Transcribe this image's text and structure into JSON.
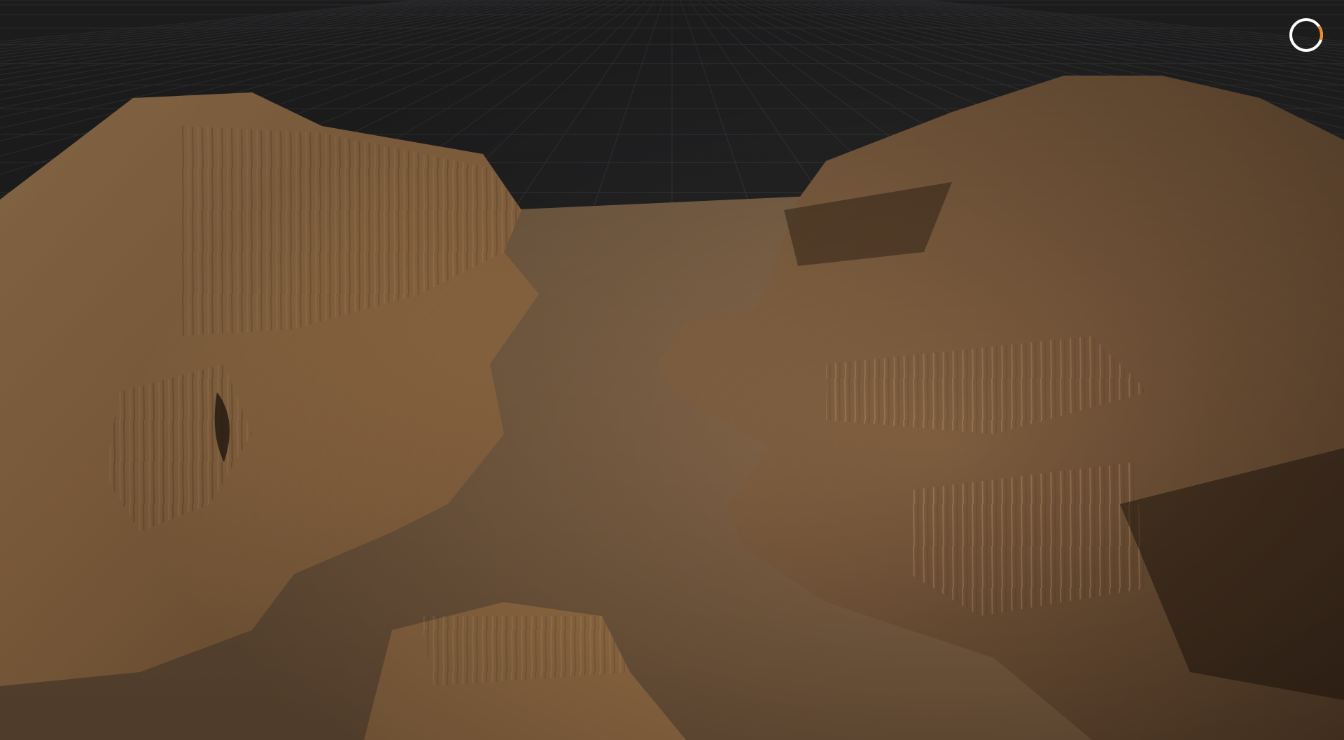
{
  "viewport": {
    "background_color": "#2a2a2b",
    "grid_color": "#3d3d40",
    "terrain": {
      "base_color": "#a57a4c",
      "highlight_color": "#d9a66c",
      "shadow_color": "#3a2a1c",
      "valley_floor_color": "#8c6a48"
    }
  },
  "overlay": {
    "loading_indicator": {
      "icon": "loading-spinner-icon",
      "ring_color": "#ffffff",
      "accent_color": "#f08a24",
      "progress": 0.12
    }
  }
}
